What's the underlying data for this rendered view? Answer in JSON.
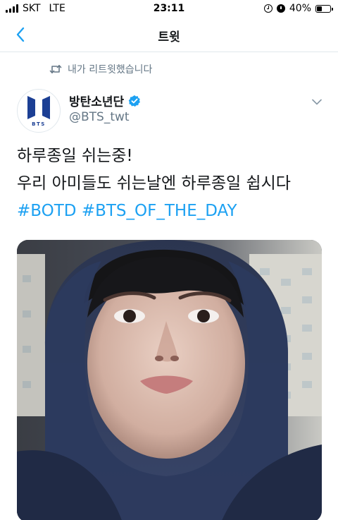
{
  "status_bar": {
    "carrier": "SKT",
    "network": "LTE",
    "time": "23:11",
    "battery": "40%",
    "battery_level": 0.4
  },
  "nav": {
    "title": "트윗"
  },
  "retweet_context": {
    "text": "내가 리트윗했습니다"
  },
  "author": {
    "name": "방탄소년단",
    "handle": "@BTS_twt",
    "avatar_text": "BTS"
  },
  "tweet": {
    "line1": "하루종일 쉬는중!",
    "line2": "우리 아미들도 쉬는날엔 하루종일 쉽시다",
    "hashtag1": "#BOTD",
    "hashtag2": "#BTS_OF_THE_DAY"
  },
  "colors": {
    "accent": "#1da1f2",
    "secondary_text": "#657786",
    "primary_text": "#14171a",
    "bts_logo": "#1c3f94"
  }
}
